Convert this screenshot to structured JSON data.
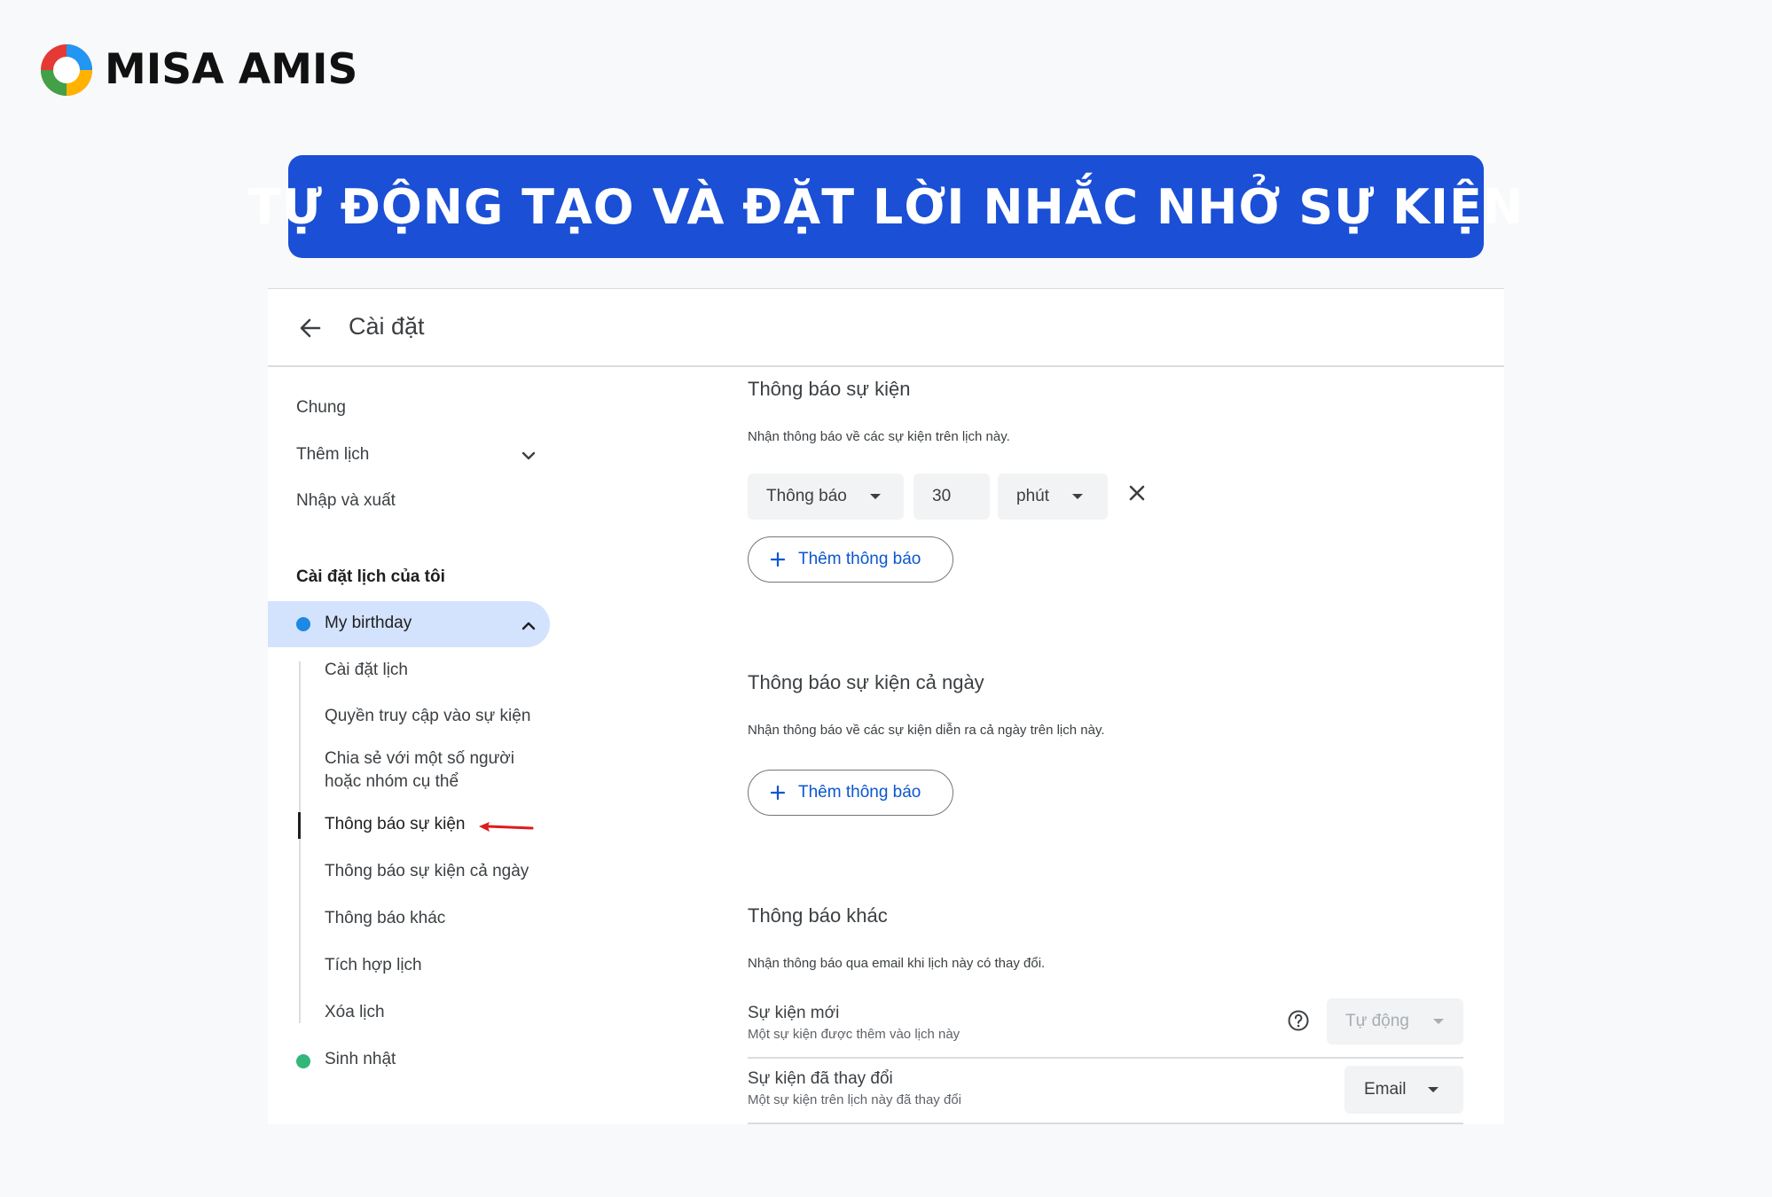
{
  "brand": {
    "name": "MISA AMIS"
  },
  "banner": {
    "title": "TỰ ĐỘNG TẠO VÀ ĐẶT LỜI NHẮC NHỞ SỰ KIỆN"
  },
  "header": {
    "title": "Cài đặt",
    "back_icon": "arrow-left-icon"
  },
  "sidebar": {
    "general": "Chung",
    "add_calendar": "Thêm lịch",
    "import_export": "Nhập và xuất",
    "my_settings_heading": "Cài đặt lịch của tôi",
    "calendars": [
      {
        "label": "My birthday",
        "color": "#1e88e5"
      },
      {
        "label": "Sinh nhật",
        "color": "#33b679"
      }
    ],
    "sub_items": [
      "Cài đặt lịch",
      "Quyền truy cập vào sự kiện",
      "Chia sẻ với một số người",
      "hoặc nhóm cụ thể",
      "Thông báo sự kiện",
      "Thông báo sự kiện cả ngày",
      "Thông báo khác",
      "Tích hợp lịch",
      "Xóa lịch"
    ]
  },
  "event_notifications": {
    "title": "Thông báo sự kiện",
    "subtitle": "Nhận thông báo về các sự kiện trên lịch này.",
    "type_value": "Thông báo",
    "amount_value": "30",
    "unit_value": "phút",
    "add_label": "Thêm thông báo"
  },
  "allday_notifications": {
    "title": "Thông báo sự kiện cả ngày",
    "subtitle": "Nhận thông báo về các sự kiện diễn ra cả ngày trên lịch này.",
    "add_label": "Thêm thông báo"
  },
  "other_notifications": {
    "title": "Thông báo khác",
    "subtitle": "Nhận thông báo qua email khi lịch này có thay đổi.",
    "rows": [
      {
        "title": "Sự kiện mới",
        "desc": "Một sự kiện được thêm vào lịch này",
        "value": "Tự động"
      },
      {
        "title": "Sự kiện đã thay đổi",
        "desc": "Một sự kiện trên lịch này đã thay đổi",
        "value": "Email"
      }
    ]
  },
  "colors": {
    "accent": "#0b57d0",
    "banner": "#1a4fd6",
    "selected": "#d3e3fd"
  }
}
